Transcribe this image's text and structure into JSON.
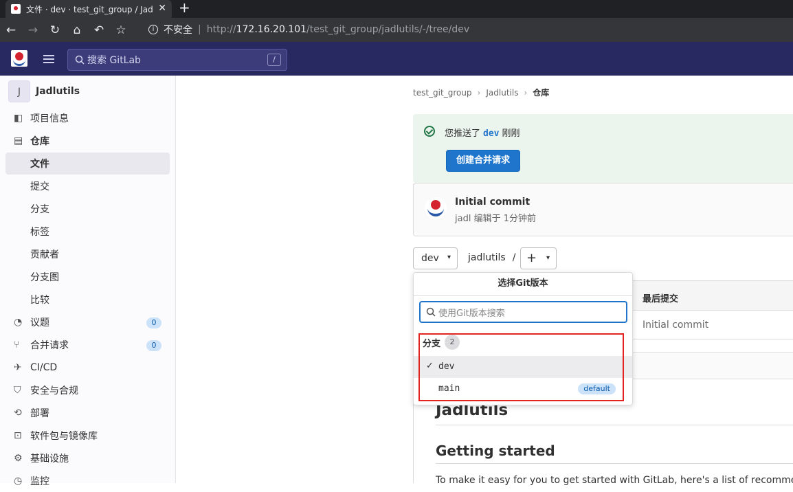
{
  "browser": {
    "tab_title": "文件 · dev · test_git_group / Jad",
    "security_label": "不安全",
    "url_scheme": "http://",
    "url_host": "172.16.20.101",
    "url_path": "/test_git_group/jadlutils/-/tree/dev"
  },
  "header": {
    "search_placeholder": "搜索 GitLab",
    "search_shortcut": "/"
  },
  "project": {
    "avatar_letter": "J",
    "name": "Jadlutils"
  },
  "sidebar": {
    "items": [
      {
        "label": "项目信息",
        "icon": "info-icon"
      },
      {
        "label": "仓库",
        "icon": "document-icon"
      },
      {
        "label": "文件"
      },
      {
        "label": "提交"
      },
      {
        "label": "分支"
      },
      {
        "label": "标签"
      },
      {
        "label": "贡献者"
      },
      {
        "label": "分支图"
      },
      {
        "label": "比较"
      },
      {
        "label": "议题",
        "icon": "issues-icon",
        "count": "0"
      },
      {
        "label": "合并请求",
        "icon": "merge-request-icon",
        "count": "0"
      },
      {
        "label": "CI/CD",
        "icon": "rocket-icon"
      },
      {
        "label": "安全与合规",
        "icon": "shield-icon"
      },
      {
        "label": "部署",
        "icon": "deployments-icon"
      },
      {
        "label": "软件包与镜像库",
        "icon": "package-icon"
      },
      {
        "label": "基础设施",
        "icon": "cloud-gear-icon"
      },
      {
        "label": "监控",
        "icon": "monitor-icon"
      }
    ]
  },
  "breadcrumb": [
    "test_git_group",
    "Jadlutils",
    "仓库"
  ],
  "alert": {
    "prefix": "您推送了",
    "branch": "dev",
    "suffix": "刚刚",
    "button": "创建合并请求"
  },
  "commit": {
    "title": "Initial commit",
    "meta": "jadl 编辑于 1分钟前"
  },
  "ref_selector": {
    "current": "dev",
    "path": "jadlutils",
    "path_sep": "/",
    "add_symbol": "+"
  },
  "tree": {
    "last_commit_header": "最后提交",
    "rows": [
      {
        "last_commit": "Initial commit"
      }
    ]
  },
  "readme": {
    "h1": "Jadlutils",
    "h2": "Getting started",
    "p": "To make it easy for you to get started with GitLab, here's a list of recommended"
  },
  "dropdown": {
    "title": "选择Git版本",
    "search_placeholder": "使用Git版本搜索",
    "section_label": "分支",
    "section_count": "2",
    "branches": [
      {
        "name": "dev",
        "selected": true,
        "check": "✓"
      },
      {
        "name": "main",
        "badge": "default"
      }
    ]
  },
  "colors": {
    "header_bg": "#292961",
    "primary_button": "#1f75cb",
    "highlight_box": "#e4231f",
    "success": "#217645"
  }
}
